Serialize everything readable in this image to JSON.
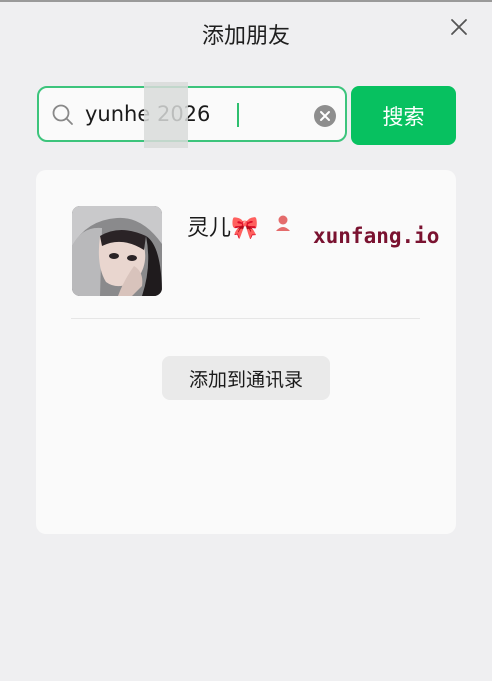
{
  "window": {
    "title": "添加朋友"
  },
  "search": {
    "value": "yunhe 2026",
    "button_label": "搜索"
  },
  "result": {
    "name": "灵儿🎀",
    "gender": "female-icon",
    "watermark": "xunfang.io"
  },
  "actions": {
    "add_contact_label": "添加到通讯录"
  },
  "colors": {
    "accent": "#07c160",
    "background": "#efeff1",
    "card": "#fafafa",
    "gender": "#e46b6b",
    "watermark": "#7a1230"
  }
}
